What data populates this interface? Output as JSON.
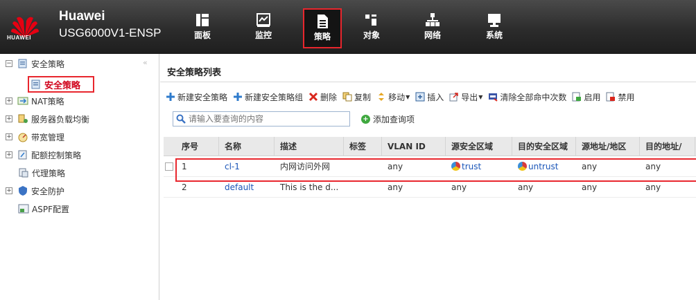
{
  "header": {
    "brand_name": "Huawei",
    "device_model": "USG6000V1-ENSP",
    "logo_text": "HUAWEI",
    "nav": [
      {
        "label": "面板",
        "icon": "dashboard-icon"
      },
      {
        "label": "监控",
        "icon": "monitor-icon"
      },
      {
        "label": "策略",
        "icon": "policy-document-icon",
        "active": true
      },
      {
        "label": "对象",
        "icon": "object-icon"
      },
      {
        "label": "网络",
        "icon": "network-icon"
      },
      {
        "label": "系统",
        "icon": "system-icon"
      }
    ]
  },
  "sidebar": {
    "collapse_glyph": "«",
    "items": [
      {
        "label": "安全策略",
        "expander": "−"
      },
      {
        "label": "安全策略",
        "selected": true
      },
      {
        "label": "NAT策略",
        "expander": "+"
      },
      {
        "label": "服务器负载均衡",
        "expander": "+"
      },
      {
        "label": "带宽管理",
        "expander": "+"
      },
      {
        "label": "配额控制策略",
        "expander": "+"
      },
      {
        "label": "代理策略"
      },
      {
        "label": "安全防护",
        "expander": "+"
      },
      {
        "label": "ASPF配置"
      }
    ]
  },
  "main": {
    "title": "安全策略列表",
    "toolbar": {
      "new_policy": "新建安全策略",
      "new_group": "新建安全策略组",
      "delete": "删除",
      "copy": "复制",
      "move": "移动",
      "insert": "插入",
      "export": "导出",
      "clear_hits": "清除全部命中次数",
      "enable": "启用",
      "disable": "禁用"
    },
    "search": {
      "placeholder": "请输入要查询的内容"
    },
    "add_query": "添加查询项",
    "columns": [
      "序号",
      "名称",
      "描述",
      "标签",
      "VLAN ID",
      "源安全区域",
      "目的安全区域",
      "源地址/地区",
      "目的地址/"
    ],
    "rows": [
      {
        "no": "1",
        "name": "cl-1",
        "desc": "内网访问外网",
        "tag": "",
        "vlan": "any",
        "src_zone": "trust",
        "dst_zone": "untrust",
        "src_addr": "any",
        "dst_addr": "any"
      },
      {
        "no": "2",
        "name": "default",
        "desc": "This is the d...",
        "tag": "",
        "vlan": "any",
        "src_zone": "any",
        "dst_zone": "any",
        "src_addr": "any",
        "dst_addr": "any"
      }
    ]
  },
  "colors": {
    "highlight": "#e8262d",
    "link": "#1a55b8",
    "header_bg": "#2c2c2c"
  }
}
